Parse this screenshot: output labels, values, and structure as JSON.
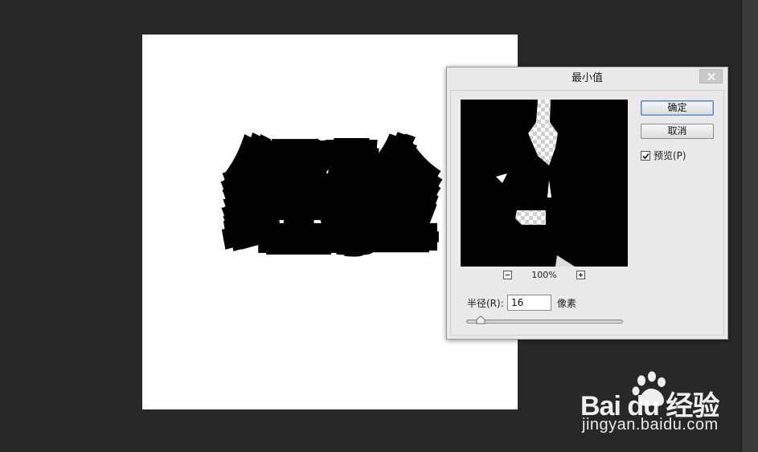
{
  "canvas": {
    "text": "经验"
  },
  "dialog": {
    "title": "最小值",
    "ok_label": "确定",
    "cancel_label": "取消",
    "preview_label": "预览(P)",
    "preview_checked": true,
    "zoom_label": "100%",
    "radius_label": "半径(R):",
    "radius_value": "16",
    "radius_unit": "像素",
    "radius_slider_fraction": 0.09
  },
  "watermark": {
    "logo": "Bai du 经验",
    "url": "jingyan.baidu.com"
  },
  "colors": {
    "workspace": "#282828",
    "dialog_bg": "#e9e9e9",
    "canvas": "#ffffff",
    "ok_border": "#4a86c8"
  },
  "icons": [
    "close-icon",
    "zoom-out-icon",
    "zoom-in-icon",
    "checkmark-icon",
    "paw-icon"
  ]
}
